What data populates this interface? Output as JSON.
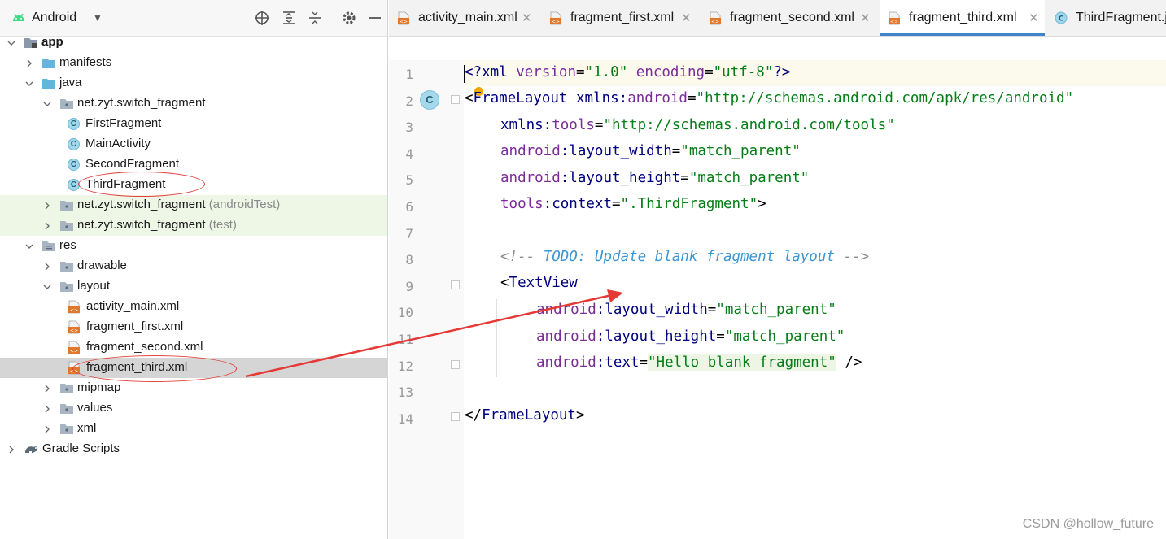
{
  "project_panel": {
    "view_name": "Android",
    "tree": [
      {
        "label": "app",
        "bold": true
      },
      {
        "label": "manifests"
      },
      {
        "label": "java"
      },
      {
        "label": "net.zyt.switch_fragment"
      },
      {
        "label": "FirstFragment"
      },
      {
        "label": "MainActivity"
      },
      {
        "label": "SecondFragment"
      },
      {
        "label": "ThirdFragment"
      },
      {
        "label": "net.zyt.switch_fragment",
        "suffix": "(androidTest)"
      },
      {
        "label": "net.zyt.switch_fragment",
        "suffix": "(test)"
      },
      {
        "label": "res"
      },
      {
        "label": "drawable"
      },
      {
        "label": "layout"
      },
      {
        "label": "activity_main.xml"
      },
      {
        "label": "fragment_first.xml"
      },
      {
        "label": "fragment_second.xml"
      },
      {
        "label": "fragment_third.xml",
        "selected": true
      },
      {
        "label": "mipmap"
      },
      {
        "label": "values"
      },
      {
        "label": "xml"
      },
      {
        "label": "Gradle Scripts"
      }
    ]
  },
  "editor": {
    "tabs": [
      {
        "label": "activity_main.xml",
        "icon": "xml-file-icon"
      },
      {
        "label": "fragment_first.xml",
        "icon": "xml-file-icon"
      },
      {
        "label": "fragment_second.xml",
        "icon": "xml-file-icon"
      },
      {
        "label": "fragment_third.xml",
        "icon": "xml-file-icon",
        "active": true
      },
      {
        "label": "ThirdFragment.j",
        "icon": "class-icon"
      }
    ],
    "line_numbers": [
      "1",
      "2",
      "3",
      "4",
      "5",
      "6",
      "7",
      "8",
      "9",
      "10",
      "11",
      "12",
      "13",
      "14"
    ],
    "code": {
      "l1": [
        "<?",
        "xml ",
        "version",
        "=",
        "\"1.0\"",
        " ",
        "encoding",
        "=",
        "\"utf-8\"",
        "?>"
      ],
      "l2": [
        "<",
        "FrameLayout",
        " ",
        "xmlns:",
        "android",
        "=",
        "\"http://schemas.android.com/apk/res/android\""
      ],
      "l3": [
        "xmlns:",
        "tools",
        "=",
        "\"http://schemas.android.com/tools\""
      ],
      "l4": [
        "android",
        ":layout_width",
        "=",
        "\"match_parent\""
      ],
      "l5": [
        "android",
        ":layout_height",
        "=",
        "\"match_parent\""
      ],
      "l6": [
        "tools",
        ":context",
        "=",
        "\".ThirdFragment\"",
        ">"
      ],
      "l8": [
        "<!-- ",
        "TODO: Update blank fragment layout",
        " -->"
      ],
      "l9": [
        "<",
        "TextView"
      ],
      "l10": [
        "android",
        ":layout_width",
        "=",
        "\"match_parent\""
      ],
      "l11": [
        "android",
        ":layout_height",
        "=",
        "\"match_parent\""
      ],
      "l12": [
        "android",
        ":text",
        "=",
        "\"Hello blank fragment\"",
        " />"
      ],
      "l14": [
        "</",
        "FrameLayout",
        ">"
      ]
    }
  },
  "watermark": "CSDN @hollow_future",
  "colors": {
    "annotation_red": "#e1423a",
    "active_tab_underline": "#4083c9",
    "xml_value": "#067d17",
    "xml_attr": "#7b2c97",
    "xml_tag": "#00007f"
  }
}
